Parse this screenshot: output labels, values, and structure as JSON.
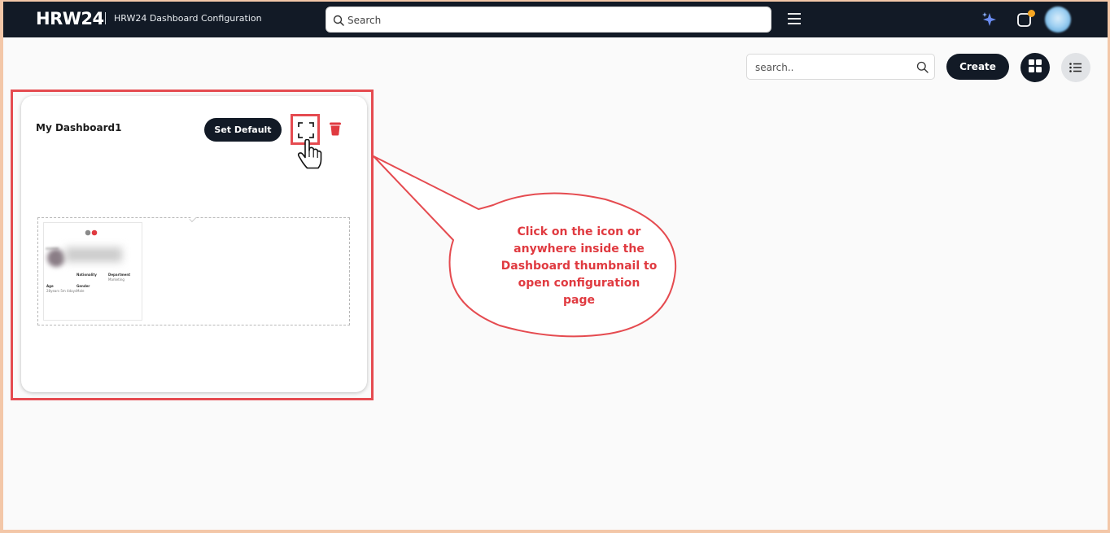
{
  "app": {
    "logo": "HRW24",
    "page_title": "HRW24 Dashboard Configuration"
  },
  "topbar": {
    "search_placeholder": "Search"
  },
  "toolbar": {
    "search_placeholder": "search..",
    "create_label": "Create"
  },
  "dashboard": {
    "title": "My Dashboard1",
    "set_default_label": "Set Default",
    "thumbnail": {
      "fields": [
        {
          "label": "Nationality",
          "value": ""
        },
        {
          "label": "Department",
          "value": "Marketing"
        },
        {
          "label": "Age",
          "value": "28years 5m 4days"
        },
        {
          "label": "Gender",
          "value": "Male"
        }
      ]
    }
  },
  "callout": {
    "lines": [
      "Click on the icon or",
      "anywhere inside the",
      "Dashboard thumbnail to",
      "open configuration",
      "page"
    ]
  },
  "colors": {
    "navbar": "#121a26",
    "annotation_red": "#e54b50",
    "trash_red": "#e03a40",
    "notification": "#f5a623"
  }
}
